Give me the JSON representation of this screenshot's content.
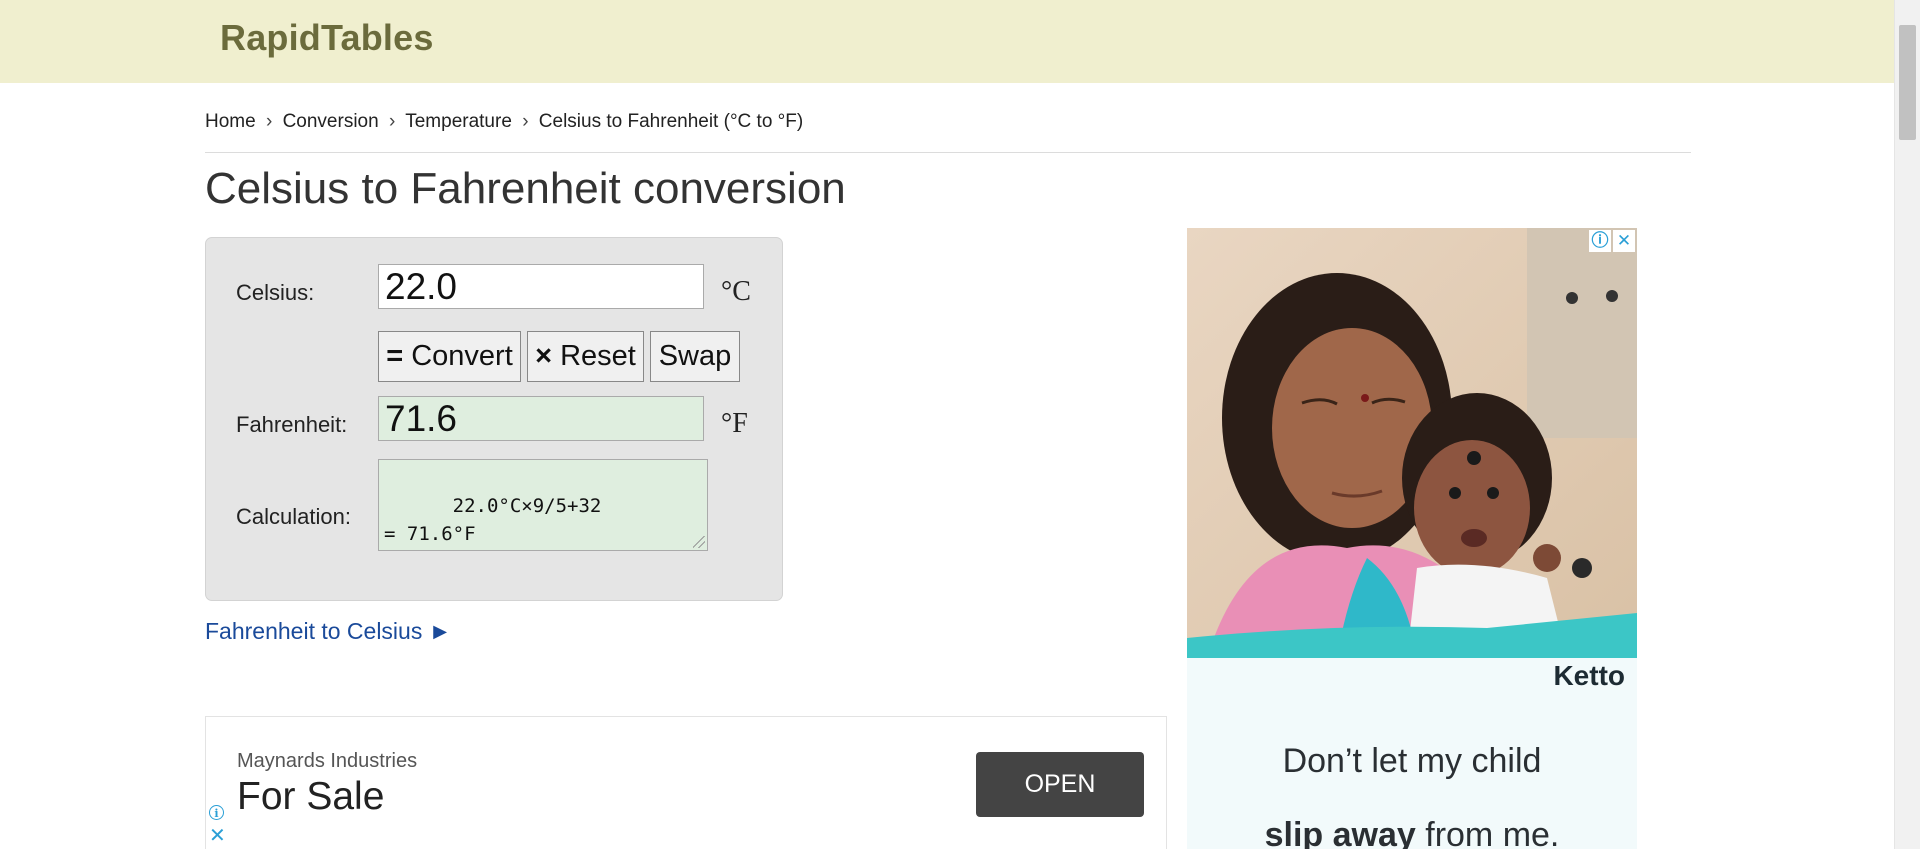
{
  "header": {
    "logo": "RapidTables"
  },
  "breadcrumb": {
    "items": [
      "Home",
      "Conversion",
      "Temperature",
      "Celsius to Fahrenheit (°C to °F)"
    ],
    "separator": "›"
  },
  "page_title": "Celsius to Fahrenheit conversion",
  "calculator": {
    "celsius_label": "Celsius:",
    "celsius_value": "22.0",
    "celsius_unit": "°C",
    "convert_label": "Convert",
    "convert_prefix": "=",
    "reset_label": "Reset",
    "reset_prefix": "×",
    "swap_label": "Swap",
    "fahrenheit_label": "Fahrenheit:",
    "fahrenheit_value": "71.6",
    "fahrenheit_unit": "°F",
    "calculation_label": "Calculation:",
    "calculation_value": "22.0°C×9/5+32\n= 71.6°F"
  },
  "links": {
    "fahrenheit_to_celsius": "Fahrenheit to Celsius ►"
  },
  "bottom_ad": {
    "company": "Maynards Industries",
    "headline": "For Sale",
    "cta": "OPEN",
    "info_icon": "info-icon",
    "close_icon": "close-icon"
  },
  "side_ad": {
    "brand": "Ketto",
    "line1": "Don’t let my child",
    "line2_bold": "slip away",
    "line2_rest": " from me.",
    "info_icon": "ⓘ",
    "close_icon": "✕"
  },
  "colors": {
    "header_bg": "#f0efcf",
    "logo": "#6b6b3c",
    "calc_bg": "#e5e5e5",
    "result_bg": "#dfeedf",
    "link": "#1a4a9a",
    "ad_button": "#444444",
    "ad_accent": "#2a9fd6"
  }
}
